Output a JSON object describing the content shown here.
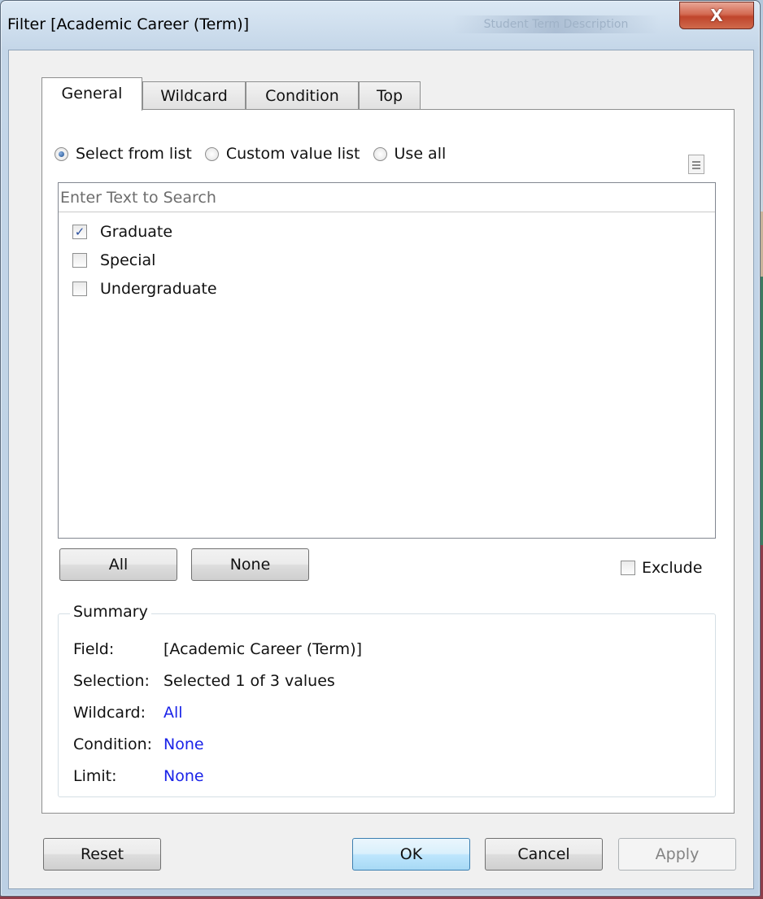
{
  "window": {
    "title": "Filter [Academic Career (Term)]",
    "background_title": "Student Term Description",
    "close_glyph": "X"
  },
  "tabs": [
    {
      "label": "General",
      "active": true
    },
    {
      "label": "Wildcard",
      "active": false
    },
    {
      "label": "Condition",
      "active": false
    },
    {
      "label": "Top",
      "active": false
    }
  ],
  "mode": {
    "options": [
      {
        "label": "Select from list",
        "checked": true
      },
      {
        "label": "Custom value list",
        "checked": false
      },
      {
        "label": "Use all",
        "checked": false
      }
    ]
  },
  "list": {
    "search_placeholder": "Enter Text to Search",
    "search_value": "",
    "items": [
      {
        "label": "Graduate",
        "checked": true
      },
      {
        "label": "Special",
        "checked": false
      },
      {
        "label": "Undergraduate",
        "checked": false
      }
    ]
  },
  "buttons": {
    "all": "All",
    "none": "None",
    "reset": "Reset",
    "ok": "OK",
    "cancel": "Cancel",
    "apply": "Apply"
  },
  "exclude": {
    "label": "Exclude",
    "checked": false
  },
  "summary": {
    "title": "Summary",
    "rows": [
      {
        "label": "Field:",
        "value": "[Academic Career (Term)]",
        "link": false
      },
      {
        "label": "Selection:",
        "value": "Selected 1 of 3 values",
        "link": false
      },
      {
        "label": "Wildcard:",
        "value": "All",
        "link": true
      },
      {
        "label": "Condition:",
        "value": "None",
        "link": true
      },
      {
        "label": "Limit:",
        "value": "None",
        "link": true
      }
    ]
  },
  "colors": {
    "link": "#1a23e8",
    "close_button": "#c0452c",
    "default_button_border": "#3c7fb1"
  }
}
